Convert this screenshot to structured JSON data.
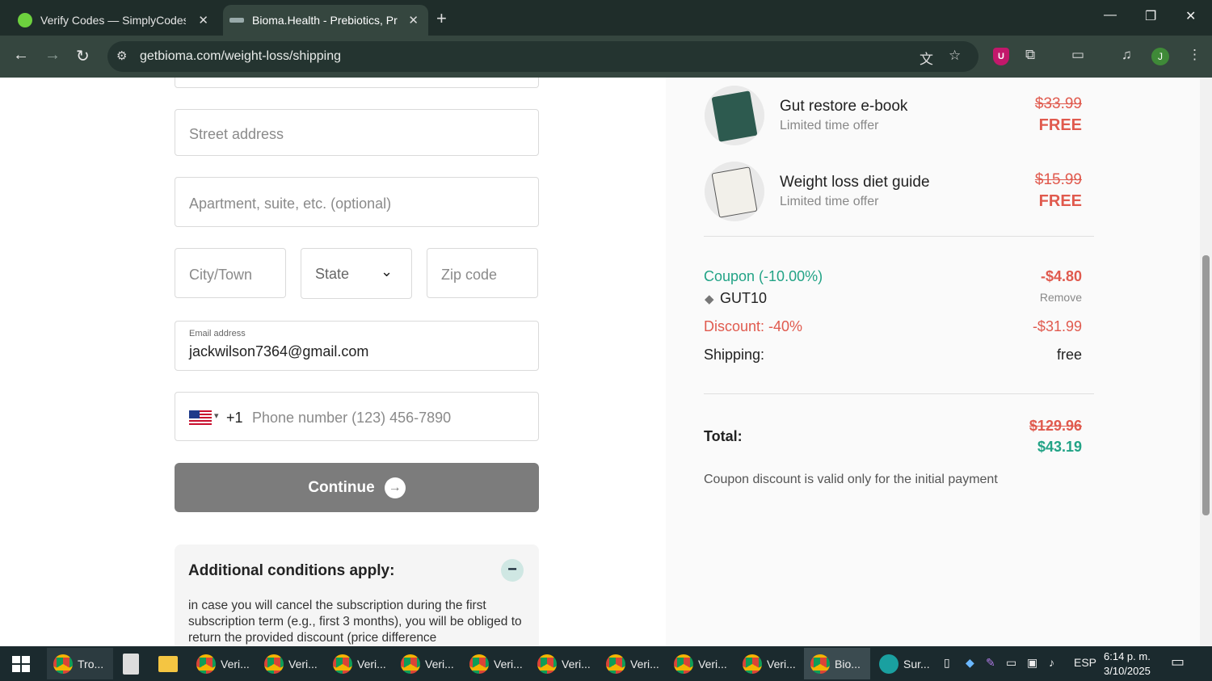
{
  "browser": {
    "tabs": [
      {
        "title": "Verify Codes — SimplyCodes",
        "active": false
      },
      {
        "title": "Bioma.Health - Prebiotics, Probiotics",
        "active": true
      }
    ],
    "url": "getbioma.com/weight-loss/shipping"
  },
  "form": {
    "street_placeholder": "Street address",
    "apartment_placeholder": "Apartment, suite, etc. (optional)",
    "city_placeholder": "City/Town",
    "state_label": "State",
    "zip_placeholder": "Zip code",
    "email_label": "Email address",
    "email_value": "jackwilson7364@gmail.com",
    "phone_code": "+1",
    "phone_placeholder": "Phone number (123) 456-7890",
    "continue_label": "Continue"
  },
  "conditions": {
    "title": "Additional conditions apply:",
    "text": "in case you will cancel the subscription during the first subscription term (e.g., first 3 months), you will be obliged to return the provided discount (price difference"
  },
  "summary": {
    "items": [
      {
        "name": "Gut restore e-book",
        "sub": "Limited time offer",
        "old_price": "$33.99",
        "price": "FREE"
      },
      {
        "name": "Weight loss diet guide",
        "sub": "Limited time offer",
        "old_price": "$15.99",
        "price": "FREE"
      }
    ],
    "coupon_label": "Coupon (-10.00%)",
    "coupon_amount": "-$4.80",
    "coupon_code": "GUT10",
    "remove_label": "Remove",
    "discount_label": "Discount: -40%",
    "discount_amount": "-$31.99",
    "shipping_label": "Shipping:",
    "shipping_value": "free",
    "total_label": "Total:",
    "total_old": "$129.96",
    "total_new": "$43.19",
    "note": "Coupon discount is valid only for the initial payment"
  },
  "colors": {
    "accent_green": "#22a386",
    "discount_red": "#e05a4e"
  },
  "taskbar": {
    "items": [
      "Tro...",
      "Veri...",
      "Veri...",
      "Veri...",
      "Veri...",
      "Veri...",
      "Veri...",
      "Veri...",
      "Veri...",
      "Veri...",
      "Bio...",
      "Sur..."
    ],
    "language": "ESP",
    "time": "6:14 p. m.",
    "date": "3/10/2025"
  }
}
